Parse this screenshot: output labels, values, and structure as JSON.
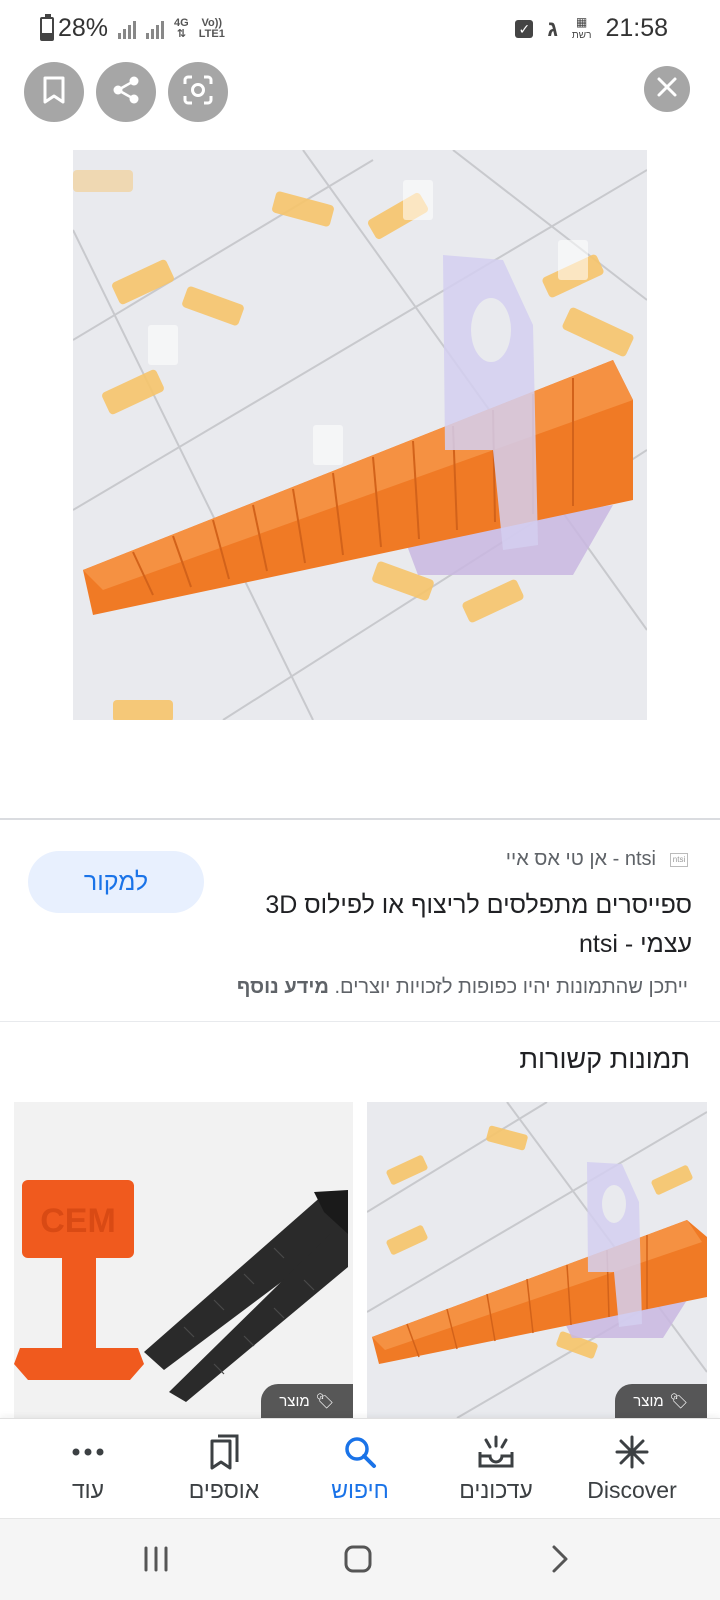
{
  "status_bar": {
    "battery": "28%",
    "network_top": "4G",
    "volte_top": "Vo))",
    "volte_bottom": "LTE1",
    "carrier_icon_text": "רשת",
    "time": "21:58"
  },
  "image_viewer": {
    "buttons": [
      "bookmark-icon",
      "share-icon",
      "lens-icon",
      "close-icon"
    ]
  },
  "result": {
    "source_name": "ntsi - אן טי אס איי",
    "favicon_text": "ntsi",
    "title": "ספייסרים מתפלסים לריצוף או לפילוס 3D עצמי - ntsi",
    "visit_label": "למקור",
    "copyright_text": "ייתכן שהתמונות יהיו כפופות לזכויות יוצרים.",
    "learn_more": "מידע נוסף"
  },
  "related": {
    "heading": "תמונות קשורות",
    "tiles": [
      {
        "badge": "מוצר"
      },
      {
        "badge": "מוצר",
        "logo_text": "CEM"
      }
    ]
  },
  "bottom_nav": {
    "items": [
      {
        "label": "Discover",
        "icon": "asterisk-icon"
      },
      {
        "label": "עדכונים",
        "icon": "updates-icon"
      },
      {
        "label": "חיפוש",
        "icon": "search-icon",
        "active": true
      },
      {
        "label": "אוספים",
        "icon": "collections-icon"
      },
      {
        "label": "עוד",
        "icon": "more-icon"
      }
    ]
  },
  "colors": {
    "accent": "#1a73e8",
    "accent_bg": "#e8f0fe",
    "spacer_orange": "#f07a25",
    "overlay_gray": "#a6a6a6"
  }
}
